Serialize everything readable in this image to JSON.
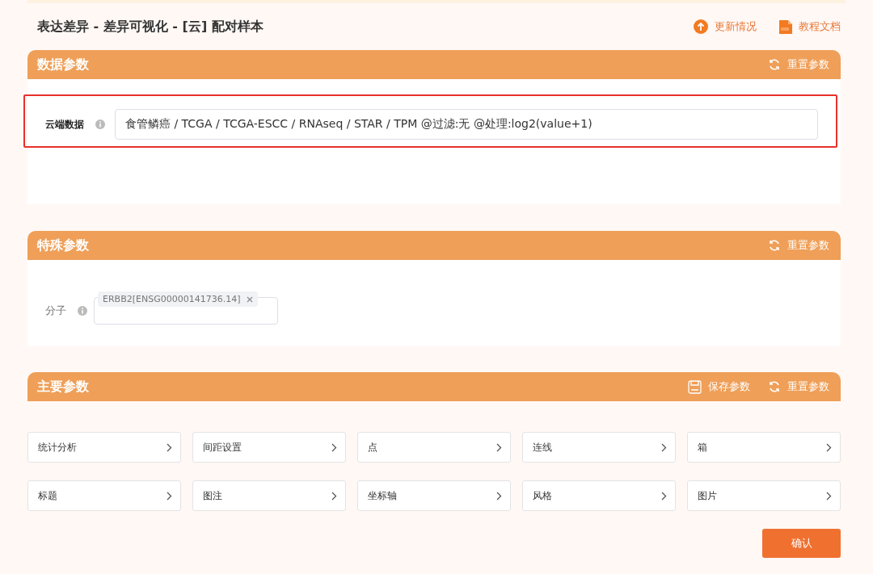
{
  "page_title": "表达差异 - 差异可视化 - [云] 配对样本",
  "header_links": [
    {
      "kind": "update",
      "label": "更新情况"
    },
    {
      "kind": "pdf",
      "label": "教程文档"
    }
  ],
  "data_panel": {
    "title": "数据参数",
    "reset": "重置参数",
    "field": {
      "label": "云端数据",
      "value": "食管鳞癌 / TCGA / TCGA-ESCC / RNAseq / STAR / TPM @过滤:无 @处理:log2(value+1)",
      "highlighted": true
    }
  },
  "special_panel": {
    "title": "特殊参数",
    "reset": "重置参数",
    "field": {
      "label": "分子",
      "tags": [
        "ERBB2[ENSG00000141736.14]"
      ]
    }
  },
  "main_panel": {
    "title": "主要参数",
    "save": "保存参数",
    "reset": "重置参数",
    "sections": [
      "统计分析",
      "间距设置",
      "点",
      "连线",
      "箱",
      "标题",
      "图注",
      "坐标轴",
      "风格",
      "图片"
    ]
  },
  "confirm_button": "确认"
}
